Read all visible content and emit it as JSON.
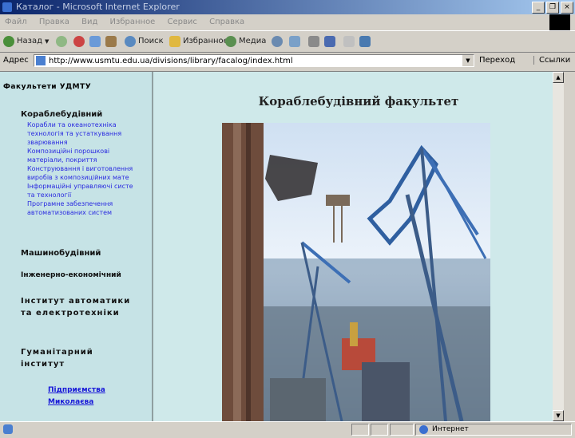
{
  "window": {
    "title": "Каталог - Microsoft Internet Explorer",
    "buttons": [
      "_",
      "❐",
      "×"
    ]
  },
  "menubar": {
    "items": [
      "Файл",
      "Правка",
      "Вид",
      "Избранное",
      "Сервис",
      "Справка"
    ]
  },
  "toolbar": {
    "back": "Назад",
    "search": "Поиск",
    "favorites": "Избранное",
    "media": "Медиа"
  },
  "address": {
    "label": "Адрес",
    "url": "http://www.usmtu.edu.ua/divisions/library/facalog/index.html",
    "go": "Переход",
    "links": "Ссылки"
  },
  "left": {
    "heading": "Факультети УДМТУ",
    "sections": [
      {
        "label": "Кораблебудівний",
        "subs": [
          "Корабли та океанотехніка",
          "технологія та устаткування",
          "зварювання",
          "Композиційні порошкові",
          "матеріали, покриття",
          "Конструювання і виготовлення",
          "виробів з композиційних мате",
          "Інформаційні управляючі систе",
          "та технології",
          "Програмне забезпечення",
          "автоматизованих систем"
        ]
      },
      {
        "label": "Машинобудівний"
      },
      {
        "label": "Інженерно-економічний"
      },
      {
        "label": "Інститут автоматики та електротехніки"
      },
      {
        "label": "Гуманітарний інститут"
      }
    ],
    "link1": "Підприємства",
    "link2": "Миколаєва"
  },
  "main": {
    "title": "Кораблебудівний факультет"
  },
  "status": {
    "zone": "Интернет"
  }
}
